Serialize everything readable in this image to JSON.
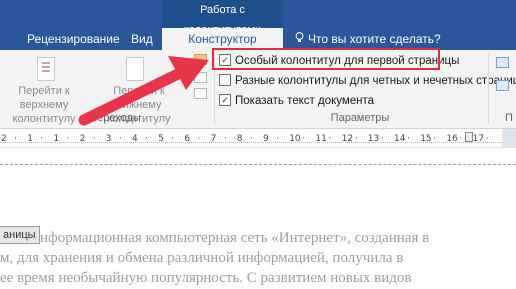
{
  "ribbon": {
    "context_group": "Работа с колонтитулами",
    "tabs": {
      "view_partial": "",
      "review": "Рецензирование",
      "vid": "Вид",
      "design": "Конструктор",
      "tell_me": "Что вы хотите сделать?"
    },
    "nav": {
      "prev_label": "Перейти к верхнему колонтитулу",
      "next_label": "Перейти к нижнему колонтитулу",
      "group_label": "Переходы"
    },
    "options": {
      "first_page": "Особый колонтитул для первой страницы",
      "first_page_checked": true,
      "odd_even": "Разные колонтитулы для четных и нечетных страниц",
      "odd_even_checked": false,
      "show_doc": "Показать текст документа",
      "show_doc_checked": true,
      "group_label": "Параметры"
    },
    "cut_group_label": "П"
  },
  "ruler": {
    "ticks": [
      "2",
      "·",
      "1",
      "·",
      "1",
      "·",
      "2",
      "·",
      "3",
      "·",
      "4",
      "·",
      "5",
      "·",
      "6",
      "·",
      "7",
      "·",
      "8",
      "·",
      "9",
      "·",
      "10",
      "·",
      "11",
      "·",
      "12",
      "·",
      "13",
      "·",
      "14",
      "·",
      "15",
      "·",
      "16",
      "·",
      "17",
      "·"
    ]
  },
  "document": {
    "header_tag": "аницы",
    "lines": [
      "информационная компьютерная сеть «Интернет», созданная в",
      "м, для хранения и обмена различной информацией, получила в",
      "ее время необычайную популярность. С развитием новых видов"
    ]
  },
  "colors": {
    "tab_band": "#2b579a",
    "ribbon_bg": "#f3f3f3",
    "highlight": "#e52b3f",
    "arrow": "#e9354a"
  }
}
